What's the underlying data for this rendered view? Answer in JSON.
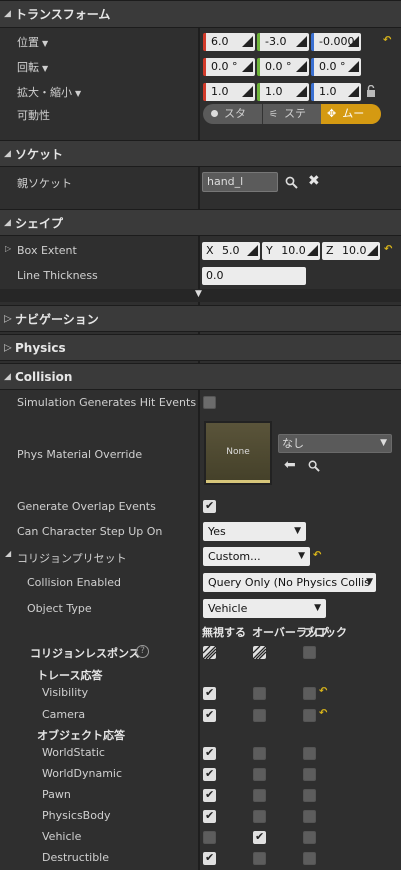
{
  "transform": {
    "header": "トランスフォーム",
    "location_label": "位置",
    "rotation_label": "回転",
    "scale_label": "拡大・縮小",
    "mobility_label": "可動性",
    "location": [
      "6.0",
      "-3.0",
      "-0.000"
    ],
    "rotation": [
      "0.0 °",
      "0.0 °",
      "0.0 °"
    ],
    "scale": [
      "1.0",
      "1.0",
      "1.0"
    ],
    "mobility_options": [
      "スタ",
      "ステ",
      "ムー"
    ]
  },
  "socket": {
    "header": "ソケット",
    "parent_label": "親ソケット",
    "parent_value": "hand_l"
  },
  "shape": {
    "header": "シェイプ",
    "box_extent_label": "Box Extent",
    "box_x_label": "X",
    "box_x": "5.0",
    "box_y_label": "Y",
    "box_y": "10.0",
    "box_z_label": "Z",
    "box_z": "10.0",
    "line_thickness_label": "Line Thickness",
    "line_thickness": "0.0"
  },
  "navigation": {
    "header": "ナビゲーション"
  },
  "physics": {
    "header": "Physics"
  },
  "collision": {
    "header": "Collision",
    "sim_hit_label": "Simulation Generates Hit Events",
    "sim_hit": false,
    "phys_material_label": "Phys Material Override",
    "phys_material_thumb": "None",
    "phys_material_value": "なし",
    "overlap_label": "Generate Overlap Events",
    "overlap": true,
    "step_up_label": "Can Character Step Up On",
    "step_up_value": "Yes",
    "preset_label": "コリジョンプリセット",
    "preset_value": "Custom...",
    "enabled_label": "Collision Enabled",
    "enabled_value": "Query Only (No Physics Collis",
    "object_type_label": "Object Type",
    "object_type_value": "Vehicle",
    "col_ignore": "無視する",
    "col_overlap": "オーバーラップ",
    "col_block": "ブロック",
    "responses_label": "コリジョンレスポンス",
    "trace_header": "トレース応答",
    "object_header": "オブジェクト応答",
    "trace_rows": [
      {
        "name": "Visibility",
        "ignore": true,
        "overlap": false,
        "block": false
      },
      {
        "name": "Camera",
        "ignore": true,
        "overlap": false,
        "block": false
      }
    ],
    "object_rows": [
      {
        "name": "WorldStatic",
        "ignore": true,
        "overlap": false,
        "block": false
      },
      {
        "name": "WorldDynamic",
        "ignore": true,
        "overlap": false,
        "block": false
      },
      {
        "name": "Pawn",
        "ignore": true,
        "overlap": false,
        "block": false
      },
      {
        "name": "PhysicsBody",
        "ignore": true,
        "overlap": false,
        "block": false
      },
      {
        "name": "Vehicle",
        "ignore": false,
        "overlap": true,
        "block": false
      },
      {
        "name": "Destructible",
        "ignore": true,
        "overlap": false,
        "block": false
      }
    ]
  },
  "icons": {
    "reset": "reset-to-default-icon",
    "lock": "lock-icon",
    "search": "search-icon",
    "clear": "clear-icon",
    "use": "use-selected-icon",
    "help": "help-icon"
  },
  "colors": {
    "x_axis": "#d23a2a",
    "y_axis": "#6fb53b",
    "z_axis": "#3a70d2",
    "movable_active": "#d59a12"
  }
}
